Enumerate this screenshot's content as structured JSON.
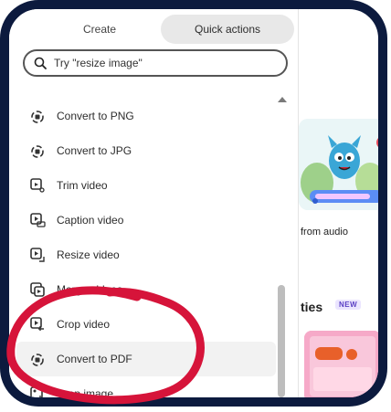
{
  "tabs": {
    "create_label": "Create",
    "quick_actions_label": "Quick actions"
  },
  "search": {
    "placeholder": "Try \"resize image\""
  },
  "quick_actions": [
    {
      "label": "Convert to PNG",
      "icon": "image-convert-icon"
    },
    {
      "label": "Convert to JPG",
      "icon": "image-convert-icon"
    },
    {
      "label": "Trim video",
      "icon": "video-trim-icon"
    },
    {
      "label": "Caption video",
      "icon": "video-caption-icon"
    },
    {
      "label": "Resize video",
      "icon": "video-resize-icon"
    },
    {
      "label": "Merge videos",
      "icon": "video-merge-icon"
    },
    {
      "label": "Crop video",
      "icon": "video-crop-icon"
    },
    {
      "label": "Convert to PDF",
      "icon": "pdf-convert-icon"
    },
    {
      "label": "Crop image",
      "icon": "image-crop-icon"
    }
  ],
  "right_panel": {
    "feature_caption": "from audio",
    "section_title": "ties",
    "badge": "NEW"
  },
  "colors": {
    "frame": "#0c1a3e",
    "annotation": "#d6143a",
    "badge": "#5a3fc4"
  }
}
